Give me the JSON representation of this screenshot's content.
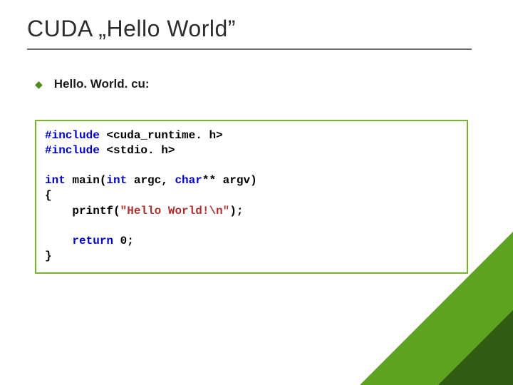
{
  "title": "CUDA „Hello World”",
  "bullet": "Hello. World. cu:",
  "code": {
    "l1_kw": "#include",
    "l1_rest": " <cuda_runtime. h>",
    "l2_kw": "#include",
    "l2_rest": " <stdio. h>",
    "l3_a": "int",
    "l3_b": " main(",
    "l3_c": "int",
    "l3_d": " argc, ",
    "l3_e": "char",
    "l3_f": "** argv)",
    "l4": "{",
    "l5_a": "    printf(",
    "l5_str": "\"Hello World!\\n\"",
    "l5_b": ");",
    "l6_a": "    ",
    "l6_kw": "return",
    "l6_b": " 0;",
    "l7": "}"
  }
}
